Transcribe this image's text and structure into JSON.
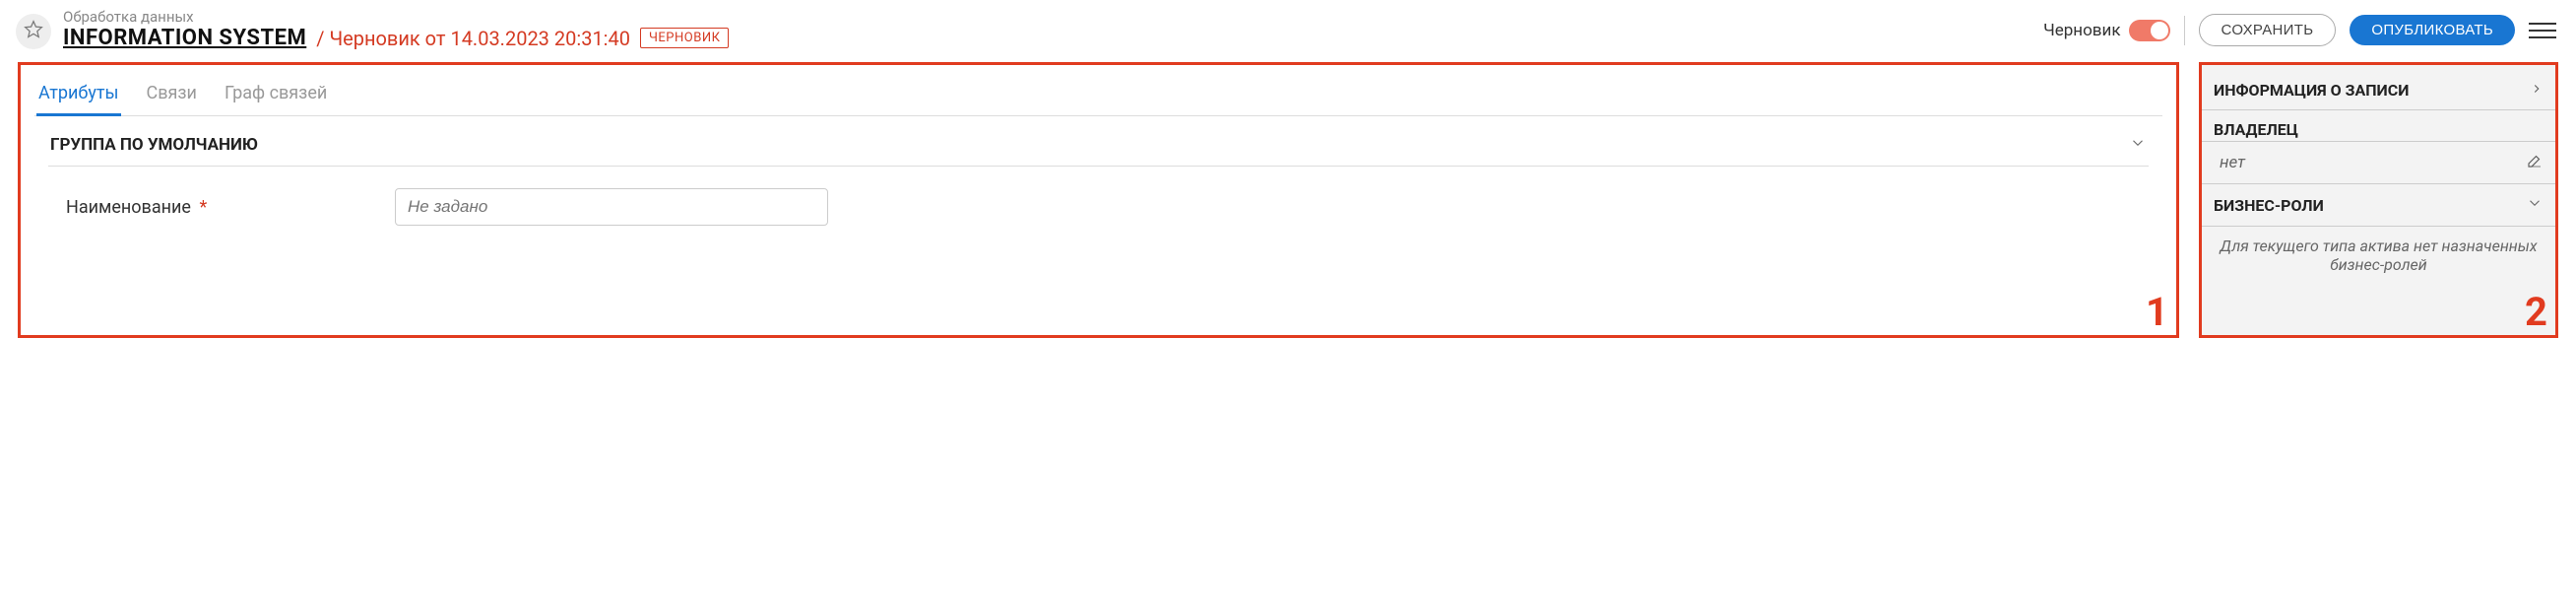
{
  "header": {
    "subtitle": "Обработка данных",
    "title": "INFORMATION SYSTEM",
    "draft_from": "/ Черновик от 14.03.2023 20:31:40",
    "badge": "ЧЕРНОВИК",
    "toggle_label": "Черновик",
    "save_label": "СОХРАНИТЬ",
    "publish_label": "ОПУБЛИКОВАТЬ"
  },
  "tabs": {
    "attributes": "Атрибуты",
    "relations": "Связи",
    "graph": "Граф связей"
  },
  "group": {
    "title": "ГРУППА ПО УМОЛЧАНИЮ",
    "field_label": "Наименование",
    "placeholder": "Не задано"
  },
  "side": {
    "info_title": "ИНФОРМАЦИЯ О ЗАПИСИ",
    "owner_title": "ВЛАДЕЛЕЦ",
    "owner_value": "нет",
    "roles_title": "БИЗНЕС-РОЛИ",
    "roles_note": "Для текущего типа актива нет назначенных бизнес-ролей"
  },
  "annotations": {
    "one": "1",
    "two": "2"
  }
}
